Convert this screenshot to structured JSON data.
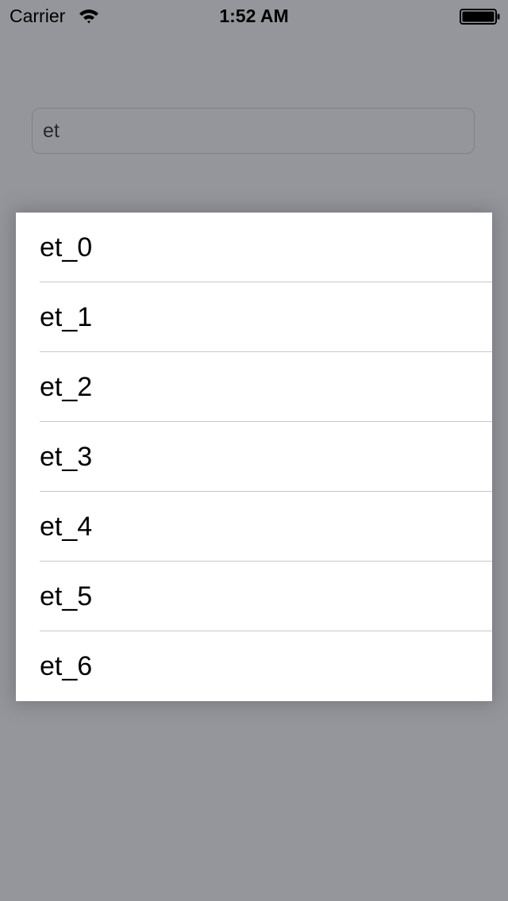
{
  "status_bar": {
    "carrier": "Carrier",
    "time": "1:52 AM",
    "wifi_icon": "wifi-icon",
    "battery_icon": "battery-icon"
  },
  "search": {
    "value": "et",
    "placeholder": ""
  },
  "suggestions": {
    "items": [
      {
        "label": "et_0"
      },
      {
        "label": "et_1"
      },
      {
        "label": "et_2"
      },
      {
        "label": "et_3"
      },
      {
        "label": "et_4"
      },
      {
        "label": "et_5"
      },
      {
        "label": "et_6"
      }
    ]
  },
  "colors": {
    "background": "#95969b",
    "panel": "#ffffff",
    "separator": "#c8c7cc",
    "text": "#000000"
  }
}
